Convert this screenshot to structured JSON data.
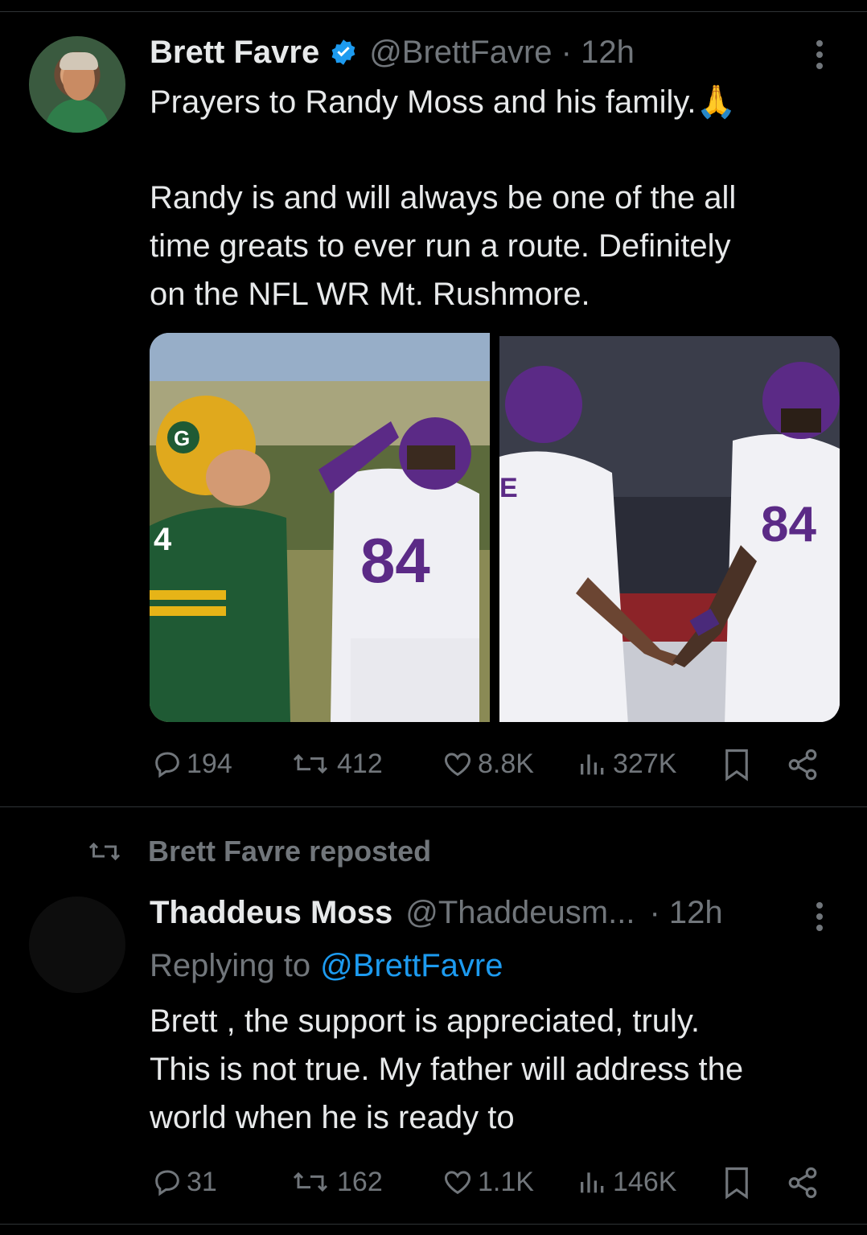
{
  "tweet1": {
    "name": "Brett Favre",
    "handle_time": "@BrettFavre · 12h",
    "line1": "Prayers to Randy Moss and his family.",
    "emoji": "🙏",
    "para2_line1": "Randy is and will always be one of the all",
    "para2_line2": "time greats to ever run a route. Definitely",
    "para2_line3": "on the NFL WR Mt. Rushmore.",
    "stats": {
      "replies": "194",
      "reposts": "412",
      "likes": "8.8K",
      "views": "327K"
    },
    "image1_text": {
      "helmet_logo": "G",
      "jersey_green": "4",
      "jersey_purple": "84"
    },
    "image2_text": {
      "jersey_purple": "84",
      "jersey_left": "E"
    }
  },
  "repost_banner": "Brett Favre reposted",
  "tweet2": {
    "name": "Thaddeus Moss",
    "handle": "@Thaddeusm...",
    "time": "· 12h",
    "replying_prefix": "Replying to",
    "replying_to": "@BrettFavre",
    "line1": "Brett , the support is appreciated, truly.",
    "line2": "This is not true. My father will address the",
    "line3": "world when he is ready to",
    "stats": {
      "replies": "31",
      "reposts": "162",
      "likes": "1.1K",
      "views": "146K"
    }
  },
  "colors": {
    "background": "#000000",
    "text": "#e7e9ea",
    "muted": "#71767b",
    "link": "#1d9bf0",
    "verified": "#1d9bf0"
  }
}
